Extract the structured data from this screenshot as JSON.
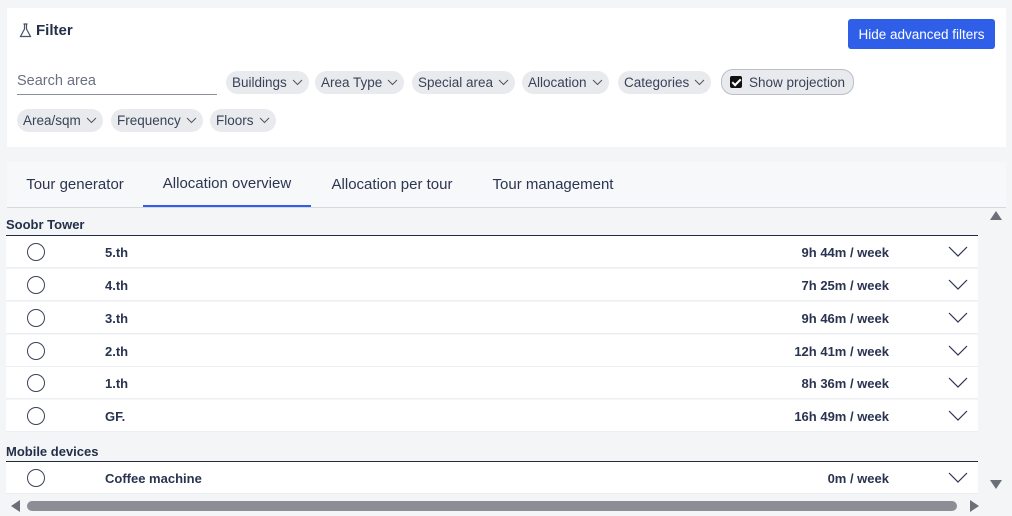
{
  "filter": {
    "title": "Filter",
    "hide_button": "Hide advanced filters",
    "search_placeholder": "Search area",
    "chips": {
      "buildings": "Buildings",
      "area_type": "Area Type",
      "special_area": "Special area",
      "allocation": "Allocation",
      "categories": "Categories",
      "show_projection": "Show projection",
      "area_sqm": "Area/sqm",
      "frequency": "Frequency",
      "floors": "Floors"
    },
    "show_projection_checked": true
  },
  "tabs": {
    "tour_generator": "Tour generator",
    "allocation_overview": "Allocation overview",
    "allocation_per_tour": "Allocation per tour",
    "tour_management": "Tour management",
    "active": "Allocation overview"
  },
  "groups": [
    {
      "name": "Soobr Tower",
      "rows": [
        {
          "name": "5.th",
          "value": "9h 44m / week"
        },
        {
          "name": "4.th",
          "value": "7h 25m / week"
        },
        {
          "name": "3.th",
          "value": "9h 46m / week"
        },
        {
          "name": "2.th",
          "value": "12h 41m / week"
        },
        {
          "name": "1.th",
          "value": "8h 36m / week"
        },
        {
          "name": "GF.",
          "value": "16h 49m / week"
        }
      ]
    },
    {
      "name": "Mobile devices",
      "rows": [
        {
          "name": "Coffee machine",
          "value": "0m / week"
        }
      ]
    }
  ],
  "colors": {
    "accent": "#2f5fe8",
    "text": "#1f2a44",
    "chip_bg": "#e8eaee"
  }
}
